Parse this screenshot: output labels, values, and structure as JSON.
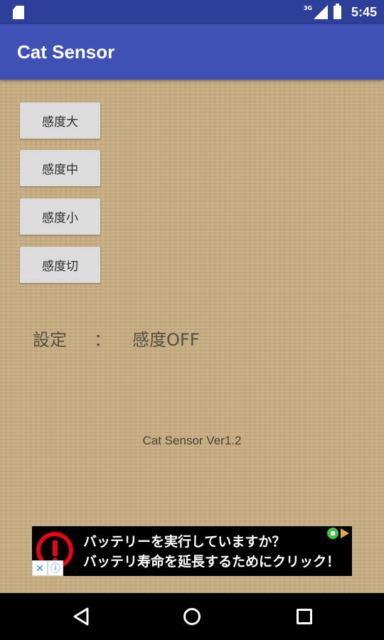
{
  "status_bar": {
    "network_type": "3G",
    "time": "5:45",
    "icons": [
      "sd-card-icon",
      "signal-icon",
      "battery-icon"
    ]
  },
  "app_bar": {
    "title": "Cat Sensor"
  },
  "sensitivity_buttons": [
    {
      "label": "感度大"
    },
    {
      "label": "感度中"
    },
    {
      "label": "感度小"
    },
    {
      "label": "感度切"
    }
  ],
  "setting": {
    "label": "設定",
    "separator": "：",
    "value": "感度OFF"
  },
  "version": "Cat Sensor Ver1.2",
  "ad": {
    "line1": "バッテリーを実行していますか？",
    "line2": "バッテリ寿命を延長するためにクリック！",
    "close_glyph": "✕",
    "info_glyph": "ⓘ"
  },
  "colors": {
    "status_bar": "#2e3f9a",
    "app_bar": "#3f51b5",
    "background": "#c6ab80",
    "button": "#dcdcdc",
    "ad_warning": "#e30613"
  }
}
